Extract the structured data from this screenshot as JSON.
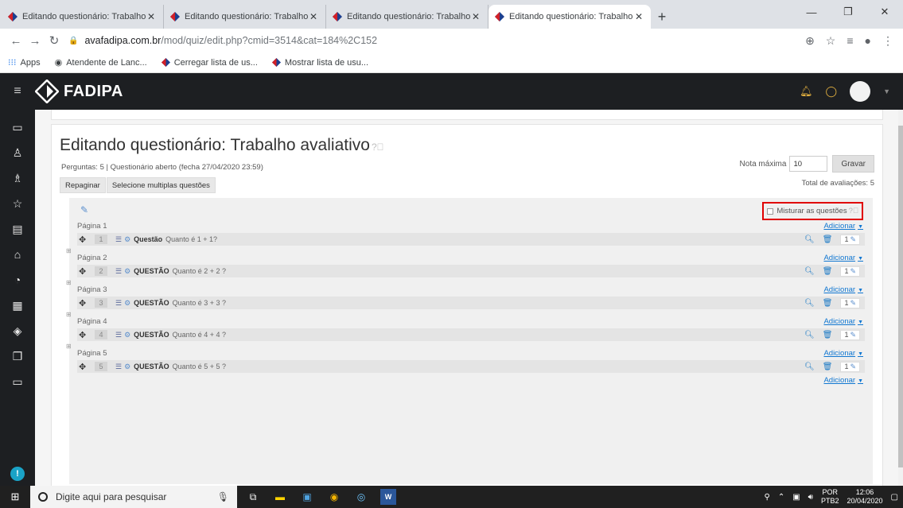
{
  "browser": {
    "tabs": [
      {
        "title": "Editando questionário: Trabalho"
      },
      {
        "title": "Editando questionário: Trabalho"
      },
      {
        "title": "Editando questionário: Trabalho"
      },
      {
        "title": "Editando questionário: Trabalho"
      }
    ],
    "url_host": "avafadipa.com.br",
    "url_path": "/mod/quiz/edit.php?cmid=3514&cat=184%2C152",
    "bookmarks": [
      {
        "label": "Apps",
        "icon": "apps-grid-icon"
      },
      {
        "label": "Atendente de Lanc...",
        "icon": "globe-icon"
      },
      {
        "label": "Cerregar lista de us...",
        "icon": "fadipa-logo-icon"
      },
      {
        "label": "Mostrar lista de usu...",
        "icon": "fadipa-logo-icon"
      }
    ]
  },
  "site": {
    "logo_text": "FADIPA"
  },
  "quiz": {
    "title": "Editando questionário: Trabalho avaliativo",
    "summary": "Perguntas: 5 | Questionário aberto (fecha 27/04/2020 23:59)",
    "repaginate_label": "Repaginar",
    "select_multiple_label": "Selecione multiplas questões",
    "max_grade_label": "Nota máxima",
    "max_grade_value": "10",
    "save_label": "Gravar",
    "total_label": "Total de avaliações: 5",
    "shuffle_label": "Misturar as questões",
    "add_label": "Adicionar",
    "pages": [
      {
        "label": "Página 1",
        "num": "1",
        "qname": "Questão",
        "qtext": "Quanto é 1 + 1?",
        "mark": "1"
      },
      {
        "label": "Página 2",
        "num": "2",
        "qname": "QUESTÃO",
        "qtext": "Quanto é 2 + 2 ?",
        "mark": "1"
      },
      {
        "label": "Página 3",
        "num": "3",
        "qname": "QUESTÃO",
        "qtext": "Quanto é 3 + 3 ?",
        "mark": "1"
      },
      {
        "label": "Página 4",
        "num": "4",
        "qname": "QUESTÃO",
        "qtext": "Quanto é 4 + 4 ?",
        "mark": "1"
      },
      {
        "label": "Página 5",
        "num": "5",
        "qname": "QUESTÃO",
        "qtext": "Quanto é 5 + 5 ?",
        "mark": "1"
      }
    ]
  },
  "taskbar": {
    "search_placeholder": "Digite aqui para pesquisar",
    "lang_top": "POR",
    "lang_bottom": "PTB2",
    "time": "12:06",
    "date": "20/04/2020"
  },
  "colors": {
    "header_bg": "#1d1f22",
    "link": "#1177d1",
    "highlight_box": "#e00000"
  }
}
